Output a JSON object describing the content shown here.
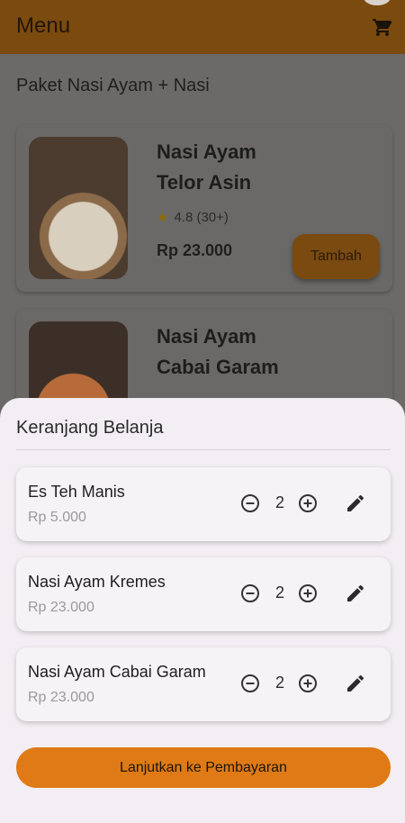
{
  "appbar": {
    "title": "Menu"
  },
  "section": {
    "title": "Paket Nasi Ayam + Nasi"
  },
  "menu_items": [
    {
      "name_line1": "Nasi Ayam",
      "name_line2": "Telor Asin",
      "rating": "4.8 (30+)",
      "price": "Rp 23.000",
      "button": "Tambah"
    },
    {
      "name_line1": "Nasi Ayam",
      "name_line2": "Cabai Garam"
    }
  ],
  "cart": {
    "title": "Keranjang Belanja",
    "items": [
      {
        "name": "Es Teh Manis",
        "price": "Rp 5.000",
        "qty": "2"
      },
      {
        "name": "Nasi Ayam Kremes",
        "price": "Rp 23.000",
        "qty": "2"
      },
      {
        "name": "Nasi Ayam Cabai Garam",
        "price": "Rp 23.000",
        "qty": "2"
      }
    ],
    "cta": "Lanjutkan ke Pembayaran"
  },
  "colors": {
    "appbar": "#7a4a0f",
    "accent": "#df7a16",
    "sheet": "#f2eef3"
  },
  "icons": [
    "cart-icon",
    "star-icon",
    "minus-circle-icon",
    "plus-circle-icon",
    "edit-pencil-icon"
  ]
}
